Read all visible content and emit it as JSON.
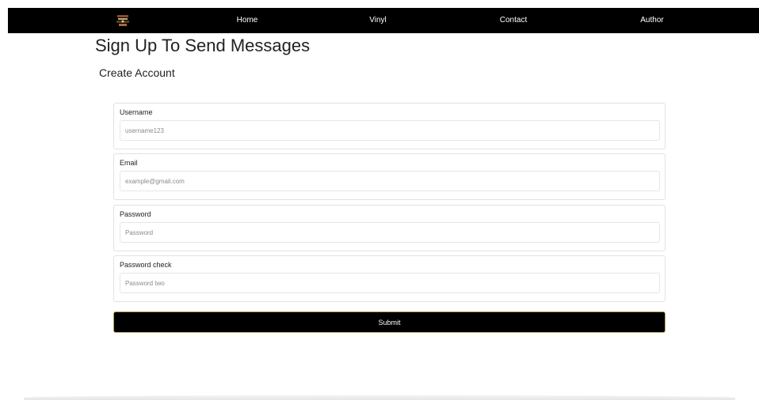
{
  "nav": {
    "logo_icon": "vinyl-record-logo-icon",
    "links": [
      "Home",
      "Vinyl",
      "Contact",
      "Author"
    ]
  },
  "page": {
    "title": "Sign Up To Send Messages",
    "subtitle": "Create Account"
  },
  "form": {
    "fields": [
      {
        "label": "Username",
        "placeholder": "username123",
        "value": ""
      },
      {
        "label": "Email",
        "placeholder": "example@gmail.com",
        "value": ""
      },
      {
        "label": "Password",
        "placeholder": "Password",
        "value": ""
      },
      {
        "label": "Password check",
        "placeholder": "Password two",
        "value": ""
      }
    ],
    "submit_label": "Submit"
  },
  "colors": {
    "navbar_bg": "#000000",
    "nav_text": "#ffffff",
    "button_bg": "#000000",
    "button_border": "#b5a35a",
    "card_border": "#e2e2e2"
  }
}
